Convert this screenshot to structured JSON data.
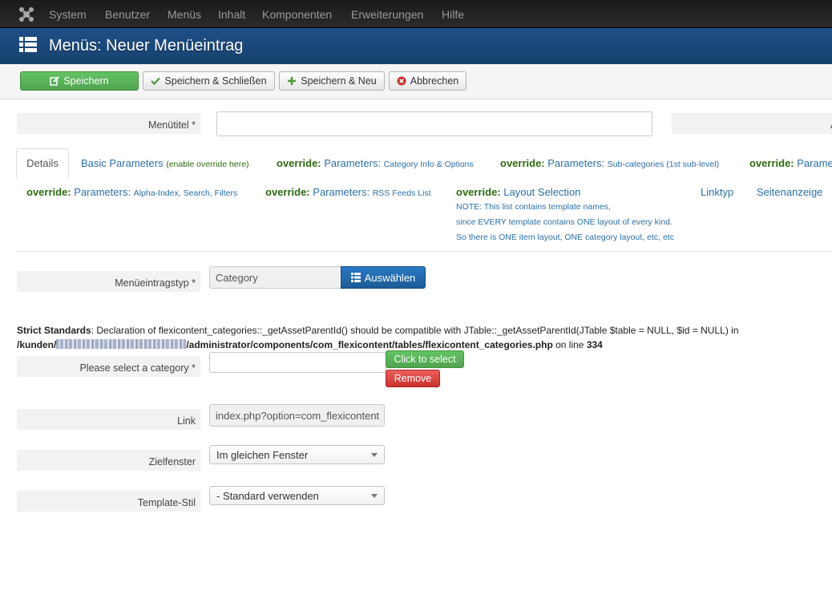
{
  "topnav": {
    "items": [
      "System",
      "Benutzer",
      "Menüs",
      "Inhalt",
      "Komponenten",
      "Erweiterungen",
      "Hilfe"
    ]
  },
  "title": "Menüs: Neuer Menüeintrag",
  "toolbar": {
    "save": "Speichern",
    "save_close": "Speichern & Schließen",
    "save_new": "Speichern & Neu",
    "cancel": "Abbrechen"
  },
  "form_top": {
    "menutitle_label": "Menütitel *",
    "menutitle_value": "",
    "alias_label_fragment": "A"
  },
  "tabs": {
    "details": "Details",
    "basic": {
      "main": "Basic Parameters",
      "small": "(enable override here)"
    },
    "row1": [
      {
        "override": "override:",
        "main": "Parameters:",
        "small": "Category Info & Options"
      },
      {
        "override": "override:",
        "main": "Parameters:",
        "small": "Sub-categories (1st sub-level)"
      },
      {
        "override": "override:",
        "main": "Parame"
      }
    ],
    "row2": [
      {
        "override": "override:",
        "main": "Parameters:",
        "small": "Alpha-Index, Search, Filters"
      },
      {
        "override": "override:",
        "main": "Parameters:",
        "small": "RSS Feeds List"
      },
      {
        "override": "override:",
        "main": "Layout Selection"
      }
    ],
    "linktyp": "Linktyp",
    "seitenanzeige": "Seitenanzeige",
    "note_lines": [
      "NOTE: This list contains template names,",
      "since EVERY template contains ONE layout of every kind.",
      "So there is ONE item layout, ONE category layout, etc, etc"
    ]
  },
  "menutype": {
    "label": "Menüeintragstyp *",
    "value": "Category",
    "button": "Auswählen"
  },
  "strict": {
    "title": "Strict Standards",
    "message": ": Declaration of flexicontent_categories::_getAssetParentId() should be compatible with JTable::_getAssetParentId(JTable $table = NULL, $id = NULL) in",
    "path_start": "/kunden/",
    "path_end": "/administrator/components/com_flexicontent/tables/flexicontent_categories.php",
    "on_line": " on line ",
    "line": "334"
  },
  "category": {
    "label": "Please select a category *",
    "value": "",
    "select_btn": "Click to select",
    "remove_btn": "Remove"
  },
  "link": {
    "label": "Link",
    "value": "index.php?option=com_flexicontent"
  },
  "target": {
    "label": "Zielfenster",
    "value": "Im gleichen Fenster"
  },
  "template_style": {
    "label": "Template-Stil",
    "value": "- Standard verwenden"
  },
  "colors": {
    "nav_bg": "#1a1a1a",
    "title_bg": "#1f4f86",
    "green": "#51a351",
    "blue_btn": "#1c5b98",
    "red_btn": "#c9302c",
    "override_green": "#2e6b10",
    "link_blue": "#2c6fa8"
  }
}
